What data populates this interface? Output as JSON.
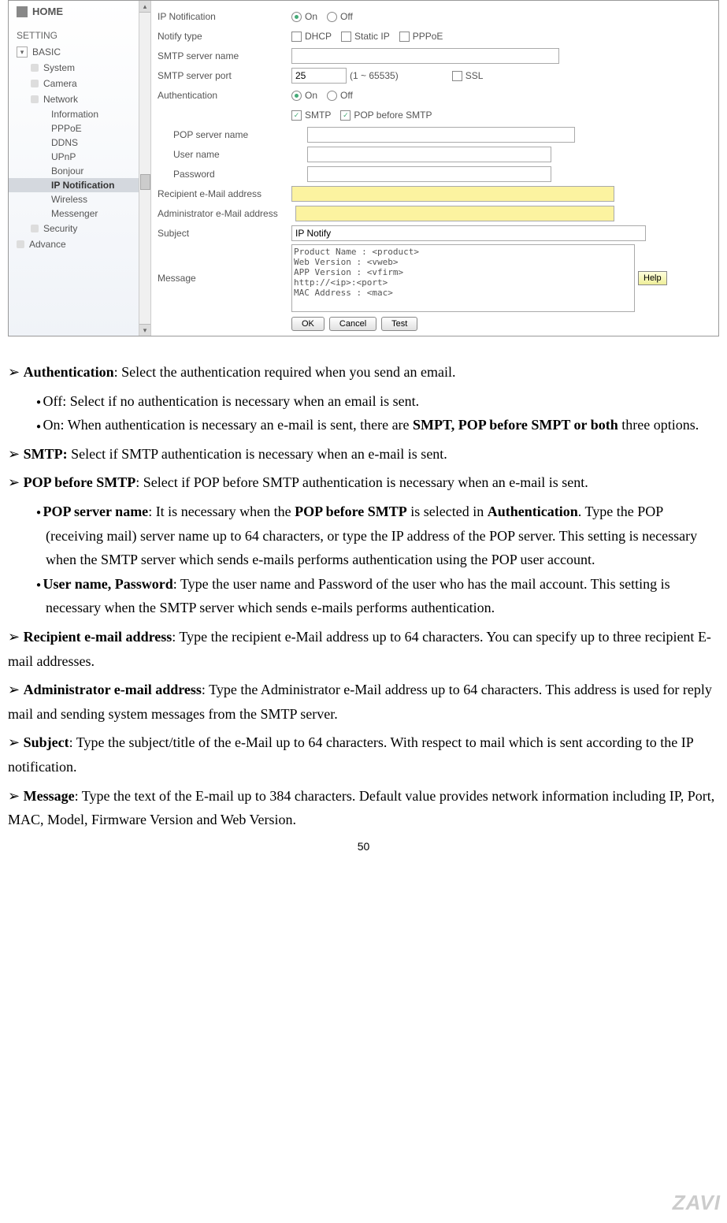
{
  "sidebar": {
    "home": "HOME",
    "setting": "SETTING",
    "basic": "BASIC",
    "system": "System",
    "camera": "Camera",
    "network": "Network",
    "network_subs": [
      "Information",
      "PPPoE",
      "DDNS",
      "UPnP",
      "Bonjour",
      "IP Notification",
      "Wireless",
      "Messenger"
    ],
    "active_sub": "IP Notification",
    "security": "Security",
    "advance": "Advance"
  },
  "form": {
    "ip_notification": "IP Notification",
    "on": "On",
    "off": "Off",
    "notify_type": "Notify type",
    "dhcp": "DHCP",
    "static_ip": "Static IP",
    "pppoe": "PPPoE",
    "smtp_server_name": "SMTP server name",
    "smtp_server_port": "SMTP server port",
    "port_value": "25",
    "port_range": "(1 ~ 65535)",
    "ssl": "SSL",
    "authentication": "Authentication",
    "smtp": "SMTP",
    "pop_before_smtp": "POP before SMTP",
    "pop_server_name": "POP server name",
    "user_name": "User name",
    "password": "Password",
    "recipient": "Recipient e-Mail address",
    "admin": "Administrator e-Mail address",
    "subject_label": "Subject",
    "subject_value": "IP Notify",
    "message_label": "Message",
    "message_value": "Product Name : <product>\nWeb Version : <vweb>\nAPP Version : <vfirm>\nhttp://<ip>:<port>\nMAC Address : <mac>",
    "ok": "OK",
    "cancel": "Cancel",
    "test": "Test",
    "help": "Help"
  },
  "doc": {
    "auth_t": "Authentication",
    "auth_d": ": Select the authentication required when you send an email.",
    "off_d": "Off: Select if no authentication is necessary when an email is sent.",
    "on_d1": "On: When authentication is necessary an e-mail is sent, there are ",
    "on_d2": "SMPT, POP before SMPT or both",
    "on_d3": " three options.",
    "smtp_t": "SMTP:",
    "smtp_d": " Select if SMTP authentication is necessary when an e-mail is sent.",
    "pop_t": "POP before SMTP",
    "pop_d": ": Select if POP before SMTP authentication is necessary when an e-mail is sent.",
    "popname_t": "POP server name",
    "popname_d1": ": It is necessary when the ",
    "popname_d2": "POP before SMTP",
    "popname_d3": " is selected in ",
    "popname_d4": "Authentication",
    "popname_d5": ". Type the POP (receiving mail) server name up to 64 characters, or type the IP address of the POP server. This setting is necessary when the SMTP server which sends e-mails performs authentication using the POP user account.",
    "userpass_t": "User name, Password",
    "userpass_d": ": Type the user name and Password of the user who has the mail account. This setting is necessary when the SMTP server which sends e-mails performs authentication.",
    "recip_t": "Recipient e-mail address",
    "recip_d": ": Type the recipient e-Mail address up to 64 characters. You can specify up to three recipient E-mail addresses.",
    "admin_t": "Administrator e-mail address",
    "admin_d": ": Type the Administrator e-Mail address up to 64 characters. This address is used for reply mail and sending system messages from the SMTP server.",
    "subj_t": "Subject",
    "subj_d": ": Type the subject/title of the e-Mail up to 64 characters. With respect to mail which is sent according to the IP notification.",
    "msg_t": "Message",
    "msg_d": ": Type the text of the E-mail up to 384 characters. Default value provides network information including IP, Port, MAC, Model, Firmware Version and Web Version."
  },
  "page_number": "50",
  "watermark": "ZAVI"
}
